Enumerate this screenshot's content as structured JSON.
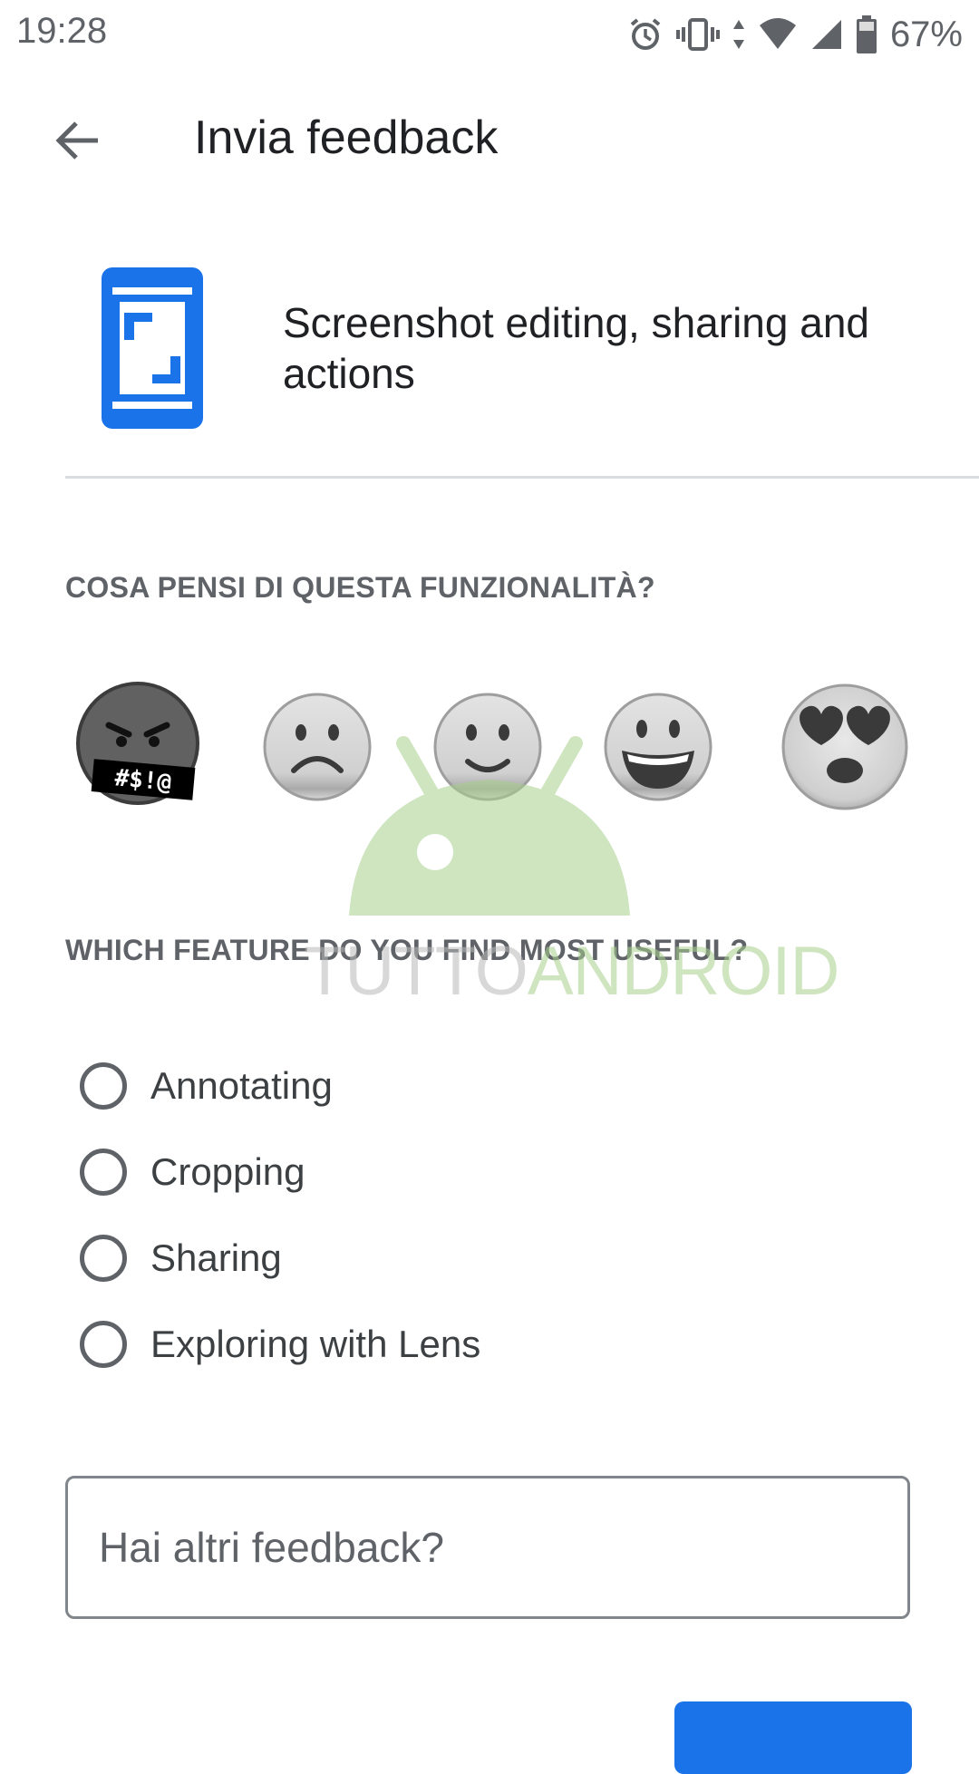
{
  "status_bar": {
    "time": "19:28",
    "battery_percent": "67%",
    "icons": [
      "alarm-icon",
      "vibrate-icon",
      "data-arrows-icon",
      "wifi-icon",
      "cell-signal-icon",
      "battery-icon"
    ]
  },
  "app_bar": {
    "back_icon": "arrow-back-icon",
    "title": "Invia feedback"
  },
  "feature": {
    "icon": "screenshot-phone-icon",
    "title": "Screenshot editing, sharing and actions"
  },
  "rating_question": {
    "heading": "COSA PENSI DI QUESTA FUNZIONALITÀ?",
    "options": [
      {
        "icon": "angry-face-icon",
        "label": "#$!@"
      },
      {
        "icon": "frowning-face-icon"
      },
      {
        "icon": "slightly-smiling-face-icon"
      },
      {
        "icon": "grinning-face-icon"
      },
      {
        "icon": "heart-eyes-face-icon"
      }
    ]
  },
  "feature_question": {
    "heading": "WHICH FEATURE DO YOU FIND MOST USEFUL?",
    "options": [
      {
        "label": "Annotating",
        "selected": false
      },
      {
        "label": "Cropping",
        "selected": false
      },
      {
        "label": "Sharing",
        "selected": false
      },
      {
        "label": "Exploring with Lens",
        "selected": false
      }
    ]
  },
  "feedback_input": {
    "placeholder": "Hai altri feedback?",
    "value": ""
  },
  "watermark": {
    "part1": "TUTTO",
    "part2": "ANDROID"
  },
  "colors": {
    "accent": "#1a73e8",
    "watermark_green": "#a8d08d"
  }
}
